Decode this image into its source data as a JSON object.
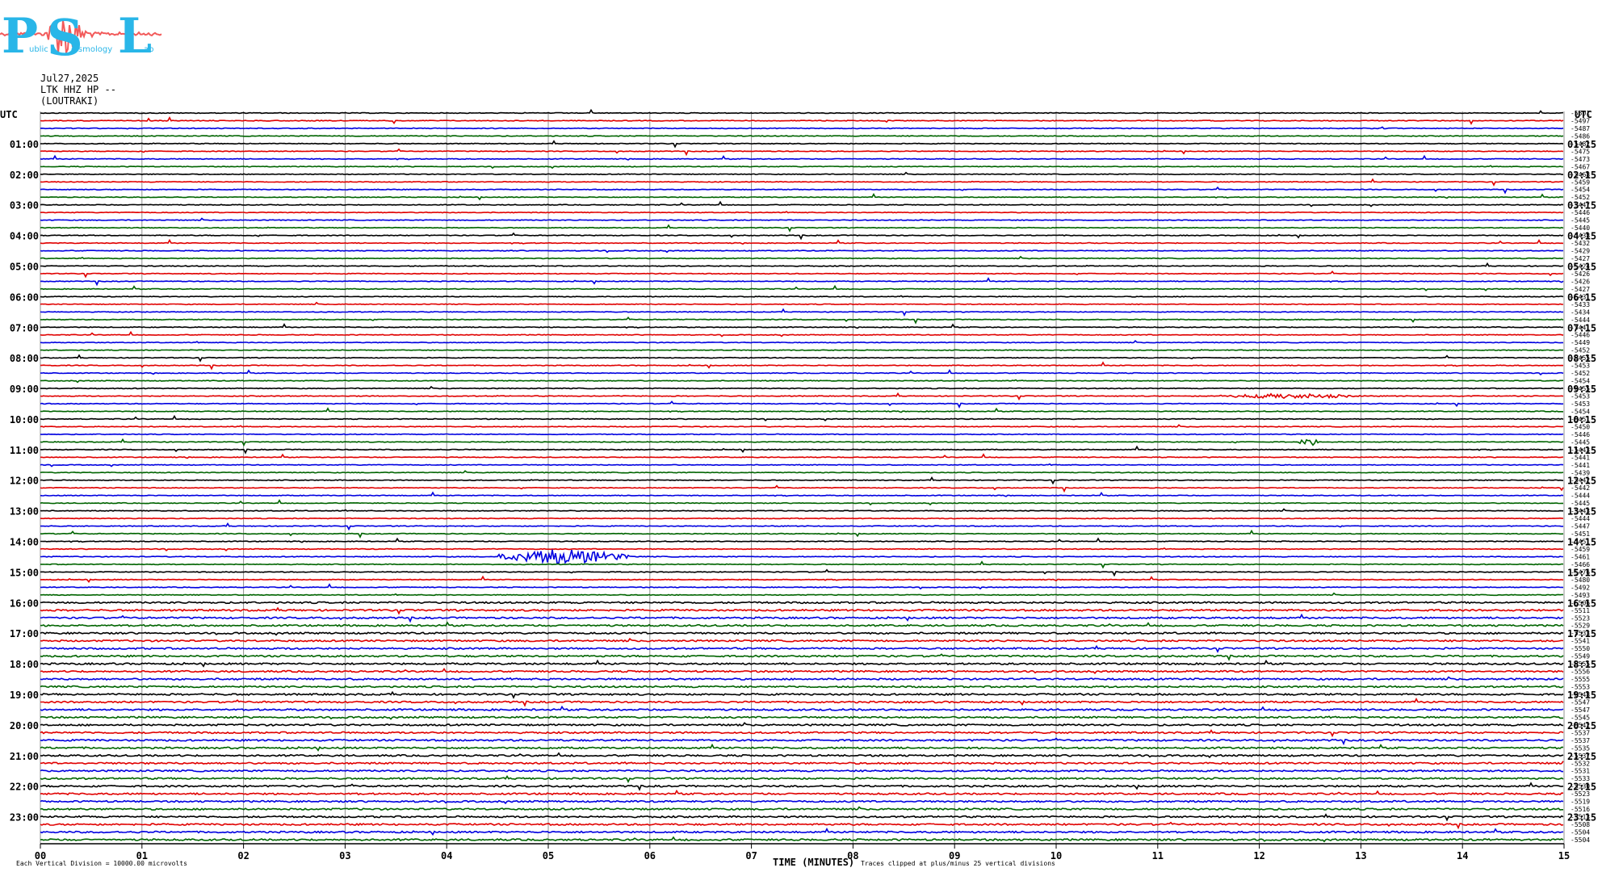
{
  "logo": {
    "letters": [
      "P",
      "S",
      "L"
    ],
    "words": [
      "ublic",
      "eismology",
      "ab"
    ],
    "colors": {
      "letters": "#29b6e8",
      "wave": "#f25a5a"
    }
  },
  "header": {
    "date": "Jul27,2025",
    "station": "LTK HHZ HP --",
    "location": "(LOUTRAKI)"
  },
  "footer": {
    "division_note": "Each Vertical Division = 10000.00 microvolts",
    "xlabel": "TIME (MINUTES)",
    "clip_note": "Traces clipped at plus/minus 25 vertical divisions"
  },
  "chart_data": {
    "type": "line",
    "title": "",
    "xlabel": "TIME (MINUTES)",
    "ylabel": "",
    "xlim": [
      0,
      15
    ],
    "grid": true,
    "x_tick_labels": [
      "00",
      "01",
      "02",
      "03",
      "04",
      "05",
      "06",
      "07",
      "08",
      "09",
      "10",
      "11",
      "12",
      "13",
      "14",
      "15"
    ],
    "left_axis_title": "UTC",
    "right_axis_title": "UTC",
    "left_hour_labels": [
      "01:00",
      "02:00",
      "03:00",
      "04:00",
      "05:00",
      "06:00",
      "07:00",
      "08:00",
      "09:00",
      "10:00",
      "11:00",
      "12:00",
      "13:00",
      "14:00",
      "15:00",
      "16:00",
      "17:00",
      "18:00",
      "19:00",
      "20:00",
      "21:00",
      "22:00",
      "23:00"
    ],
    "right_hour_labels": [
      "01:15",
      "02:15",
      "03:15",
      "04:15",
      "05:15",
      "06:15",
      "07:15",
      "08:15",
      "09:15",
      "10:15",
      "11:15",
      "12:15",
      "13:15",
      "14:15",
      "15:15",
      "16:15",
      "17:15",
      "18:15",
      "19:15",
      "20:15",
      "21:15",
      "22:15",
      "23:15"
    ],
    "trace_colors": [
      "#000000",
      "#e00000",
      "#0000e0",
      "#006400"
    ],
    "trace_count": 96,
    "trace_offsets": [
      "-5501",
      "-5497",
      "-5487",
      "-5486",
      "-5482",
      "-5475",
      "-5473",
      "-5467",
      "-5468",
      "-5459",
      "-5454",
      "-5452",
      "-5447",
      "-5446",
      "-5445",
      "-5440",
      "-5438",
      "-5432",
      "-5429",
      "-5427",
      "-5424",
      "-5426",
      "-5426",
      "-5427",
      "-5431",
      "-5433",
      "-5434",
      "-5444",
      "-5441",
      "-5446",
      "-5449",
      "-5452",
      "-5455",
      "-5453",
      "-5452",
      "-5454",
      "-5455",
      "-5453",
      "-5453",
      "-5454",
      "-5451",
      "-5450",
      "-5446",
      "-5445",
      "-5443",
      "-5441",
      "-5441",
      "-5439",
      "-5442",
      "-5442",
      "-5444",
      "-5445",
      "-5443",
      "-5444",
      "-5447",
      "-5451",
      "-5451",
      "-5459",
      "-5461",
      "-5466",
      "-5476",
      "-5480",
      "-5492",
      "-5493",
      "-5506",
      "-5511",
      "-5523",
      "-5529",
      "-5533",
      "-5541",
      "-5550",
      "-5549",
      "-5555",
      "-5556",
      "-5555",
      "-5553",
      "-5548",
      "-5547",
      "-5547",
      "-5545",
      "-5542",
      "-5537",
      "-5537",
      "-5535",
      "-5537",
      "-5532",
      "-5531",
      "-5533",
      "-5530",
      "-5523",
      "-5519",
      "-5516",
      "-5513",
      "-5508",
      "-5504",
      "-5504"
    ],
    "events": [
      {
        "row": 58,
        "start_min": 4.5,
        "end_min": 5.8,
        "amplitude": "large"
      },
      {
        "row": 43,
        "start_min": 12.4,
        "end_min": 12.6,
        "amplitude": "medium"
      },
      {
        "row": 37,
        "start_min": 11.6,
        "end_min": 13.0,
        "amplitude": "small"
      }
    ]
  }
}
